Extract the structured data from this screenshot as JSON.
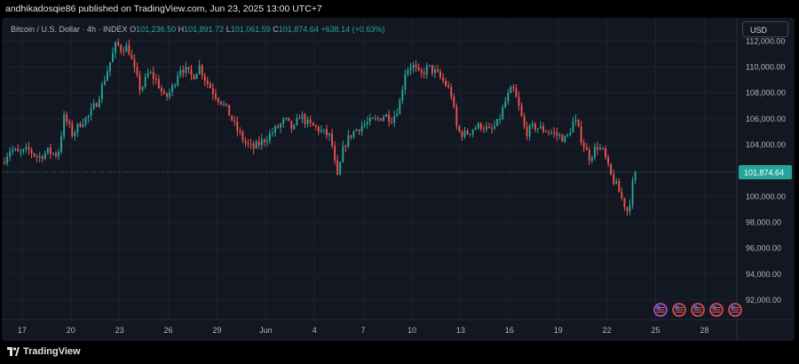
{
  "header": {
    "publish_note": "andhikadosqie86 published on TradingView.com, Jun 23, 2025 13:00 UTC+7"
  },
  "chart_header": {
    "symbol": "Bitcoin / U.S. Dollar · 4h · INDEX",
    "open_label": "O",
    "open": "101,236.50",
    "high_label": "H",
    "high": "101,891.72",
    "low_label": "L",
    "low": "101,061.59",
    "close_label": "C",
    "close": "101,874.64",
    "change": "+638.14 (+0.63%)",
    "currency_button": "USD"
  },
  "footer": {
    "brand": "TradingView"
  },
  "chart_data": {
    "type": "candlestick",
    "interval": "4h",
    "y_ticks": [
      "112,000.00",
      "110,000.00",
      "108,000.00",
      "106,000.00",
      "104,000.00",
      "100,000.00",
      "98,000.00",
      "96,000.00",
      "94,000.00",
      "92,000.00"
    ],
    "y_tick_values": [
      112000,
      110000,
      108000,
      106000,
      104000,
      100000,
      98000,
      96000,
      94000,
      92000
    ],
    "x_ticks": [
      "17",
      "20",
      "23",
      "26",
      "29",
      "Jun",
      "4",
      "7",
      "10",
      "13",
      "16",
      "19",
      "22",
      "25",
      "28"
    ],
    "x_tick_days": [
      17,
      20,
      23,
      26,
      29,
      32,
      35,
      38,
      41,
      44,
      47,
      50,
      53,
      56,
      59
    ],
    "x_start_day": 15.75,
    "x_end_day": 61,
    "ylim": [
      90500,
      113800
    ],
    "last_price": 101874.64,
    "last_price_label": "101,874.64",
    "colors": {
      "up": "#26a69a",
      "down": "#ef5350",
      "background": "#131722",
      "grid": "#1e222d",
      "axis_text": "#b2b5be"
    },
    "anchors": [
      [
        15.75,
        102600
      ],
      [
        16.3,
        103700
      ],
      [
        16.8,
        103300
      ],
      [
        17.4,
        103600
      ],
      [
        18.0,
        103000
      ],
      [
        18.6,
        103500
      ],
      [
        19.2,
        103200
      ],
      [
        19.6,
        106200
      ],
      [
        20.1,
        104800
      ],
      [
        20.6,
        105700
      ],
      [
        21.1,
        106200
      ],
      [
        21.6,
        107300
      ],
      [
        22.0,
        108800
      ],
      [
        22.5,
        110700
      ],
      [
        22.8,
        111800
      ],
      [
        23.1,
        111400
      ],
      [
        23.5,
        111600
      ],
      [
        23.9,
        109800
      ],
      [
        24.3,
        108200
      ],
      [
        24.8,
        109600
      ],
      [
        25.3,
        108900
      ],
      [
        25.8,
        107500
      ],
      [
        26.3,
        108500
      ],
      [
        26.7,
        110000
      ],
      [
        27.1,
        109700
      ],
      [
        27.5,
        109200
      ],
      [
        27.9,
        110100
      ],
      [
        28.3,
        109000
      ],
      [
        28.8,
        108000
      ],
      [
        29.3,
        107300
      ],
      [
        29.7,
        106500
      ],
      [
        30.2,
        105200
      ],
      [
        30.7,
        104200
      ],
      [
        31.2,
        103700
      ],
      [
        31.7,
        104200
      ],
      [
        32.2,
        104700
      ],
      [
        32.7,
        105300
      ],
      [
        33.2,
        105900
      ],
      [
        33.7,
        105100
      ],
      [
        34.1,
        106300
      ],
      [
        34.6,
        105600
      ],
      [
        35.1,
        105300
      ],
      [
        35.6,
        104900
      ],
      [
        36.0,
        104600
      ],
      [
        36.4,
        101300
      ],
      [
        36.8,
        103900
      ],
      [
        37.3,
        104900
      ],
      [
        37.8,
        105400
      ],
      [
        38.3,
        105700
      ],
      [
        38.8,
        105900
      ],
      [
        39.3,
        106300
      ],
      [
        39.8,
        106000
      ],
      [
        40.2,
        107000
      ],
      [
        40.6,
        109700
      ],
      [
        41.0,
        110200
      ],
      [
        41.5,
        109300
      ],
      [
        42.0,
        110000
      ],
      [
        42.5,
        109500
      ],
      [
        43.0,
        108800
      ],
      [
        43.4,
        108000
      ],
      [
        43.8,
        105000
      ],
      [
        44.3,
        104800
      ],
      [
        44.8,
        105300
      ],
      [
        45.3,
        105500
      ],
      [
        45.8,
        105000
      ],
      [
        46.3,
        105700
      ],
      [
        46.8,
        107500
      ],
      [
        47.2,
        108400
      ],
      [
        47.6,
        106800
      ],
      [
        48.0,
        104900
      ],
      [
        48.5,
        105400
      ],
      [
        49.0,
        105200
      ],
      [
        49.5,
        105000
      ],
      [
        50.0,
        104700
      ],
      [
        50.5,
        104400
      ],
      [
        51.0,
        106000
      ],
      [
        51.5,
        104200
      ],
      [
        51.9,
        103000
      ],
      [
        52.4,
        103900
      ],
      [
        52.8,
        103400
      ],
      [
        53.2,
        101700
      ],
      [
        53.6,
        100800
      ],
      [
        54.0,
        99600
      ],
      [
        54.3,
        98800
      ],
      [
        54.6,
        101100
      ],
      [
        54.9,
        101874.64
      ]
    ]
  }
}
